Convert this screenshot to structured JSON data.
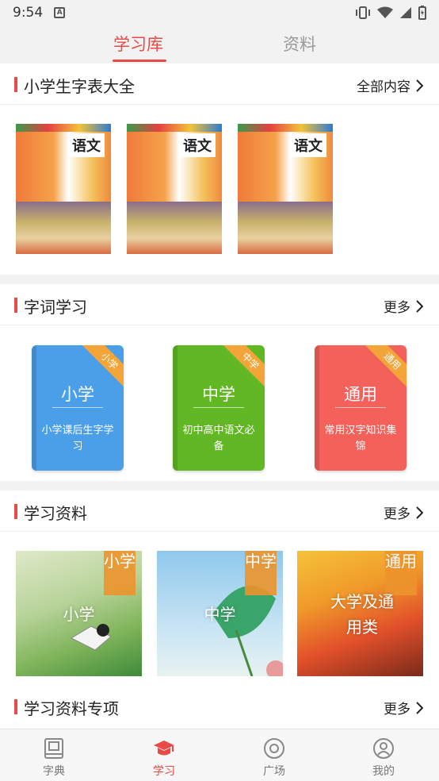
{
  "status_bar": {
    "time": "9:54",
    "badge": "A"
  },
  "top_tabs": [
    {
      "label": "学习库",
      "active": true
    },
    {
      "label": "资料",
      "active": false
    }
  ],
  "accent_color": "#e84b45",
  "section1": {
    "title": "小学生字表大全",
    "more": "全部内容",
    "cover_title": "语文"
  },
  "section2": {
    "title": "字词学习",
    "more": "更多",
    "books": [
      {
        "name": "小学",
        "desc": "小学课后生字学习",
        "ribbon": "小学",
        "color": "#4b9fe8"
      },
      {
        "name": "中学",
        "desc": "初中高中语文必备",
        "ribbon": "中学",
        "color": "#62b824"
      },
      {
        "name": "通用",
        "desc": "常用汉字知识集锦",
        "ribbon": "通用",
        "color": "#f4605a"
      }
    ]
  },
  "section3": {
    "title": "学习资料",
    "more": "更多",
    "tiles": [
      {
        "name": "小学",
        "tag": "小学"
      },
      {
        "name": "中学",
        "tag": "中学"
      },
      {
        "name": "大学及通用类",
        "tag": "通用"
      }
    ]
  },
  "section4": {
    "title": "学习资料专项",
    "more": "更多"
  },
  "bottom_nav": [
    {
      "label": "字典",
      "icon": "book-icon",
      "active": false
    },
    {
      "label": "学习",
      "icon": "graduation-cap-icon",
      "active": true
    },
    {
      "label": "广场",
      "icon": "compass-icon",
      "active": false
    },
    {
      "label": "我的",
      "icon": "user-icon",
      "active": false
    }
  ]
}
